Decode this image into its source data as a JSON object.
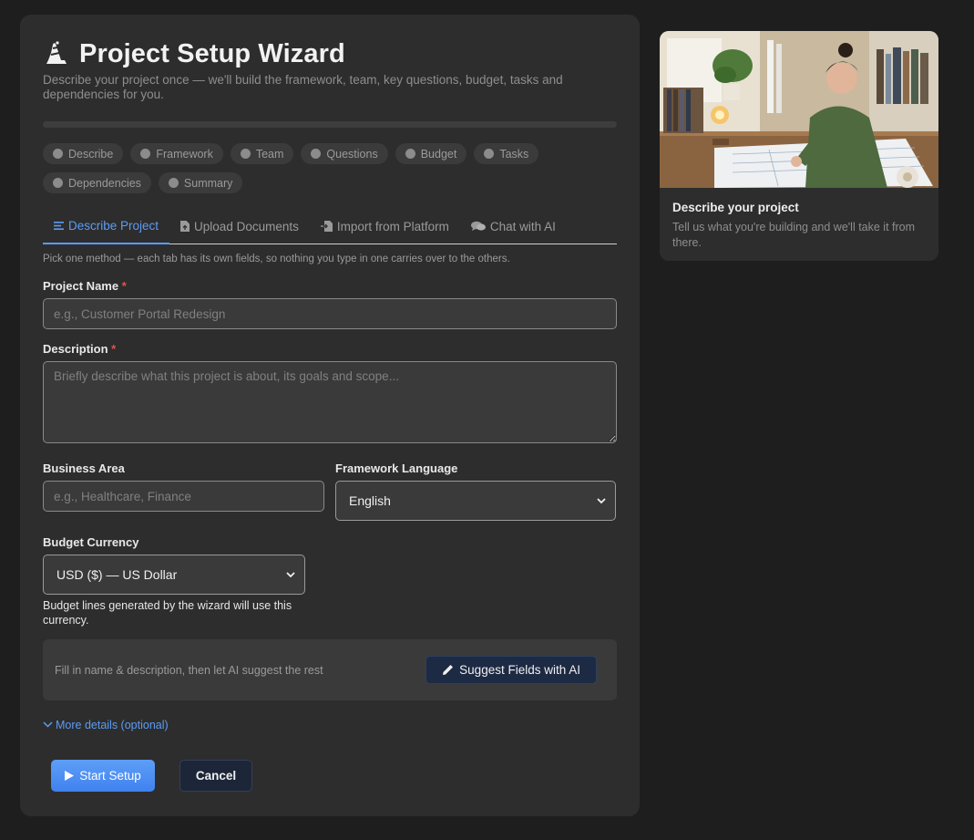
{
  "header": {
    "title": "Project Setup Wizard",
    "icon": "wizard-hat-icon",
    "subtitle": "Describe your project once — we'll build the framework, team, key questions, budget, tasks and dependencies for you."
  },
  "progress": {
    "percent": 0
  },
  "steps": [
    "Describe",
    "Framework",
    "Team",
    "Questions",
    "Budget",
    "Tasks",
    "Dependencies",
    "Summary"
  ],
  "tabs": [
    {
      "label": "Describe Project",
      "icon": "list-icon",
      "active": true
    },
    {
      "label": "Upload Documents",
      "icon": "file-upload-icon",
      "active": false
    },
    {
      "label": "Import from Platform",
      "icon": "import-icon",
      "active": false
    },
    {
      "label": "Chat with AI",
      "icon": "chat-icon",
      "active": false
    }
  ],
  "tab_hint": "Pick one method — each tab has its own fields, so nothing you type in one carries over to the others.",
  "form": {
    "project_name": {
      "label": "Project Name",
      "required_mark": "*",
      "placeholder": "e.g., Customer Portal Redesign",
      "value": ""
    },
    "description": {
      "label": "Description",
      "required_mark": "*",
      "placeholder": "Briefly describe what this project is about, its goals and scope...",
      "value": ""
    },
    "business_area": {
      "label": "Business Area",
      "placeholder": "e.g., Healthcare, Finance",
      "value": ""
    },
    "framework_language": {
      "label": "Framework Language",
      "value": "English"
    },
    "budget_currency": {
      "label": "Budget Currency",
      "value": "USD ($) — US Dollar",
      "note": "Budget lines generated by the wizard will use this currency."
    }
  },
  "ai_suggest": {
    "text": "Fill in name & description, then let AI suggest the rest",
    "button_label": "Suggest Fields with AI"
  },
  "more_details": "More details (optional)",
  "actions": {
    "start_label": "Start Setup",
    "cancel_label": "Cancel"
  },
  "side_card": {
    "title": "Describe your project",
    "text": "Tell us what you're building and we'll take it from there."
  },
  "colors": {
    "accent": "#5b9cf5",
    "required": "#e05252",
    "panel": "#2d2d2d",
    "background": "#1e1e1e"
  }
}
